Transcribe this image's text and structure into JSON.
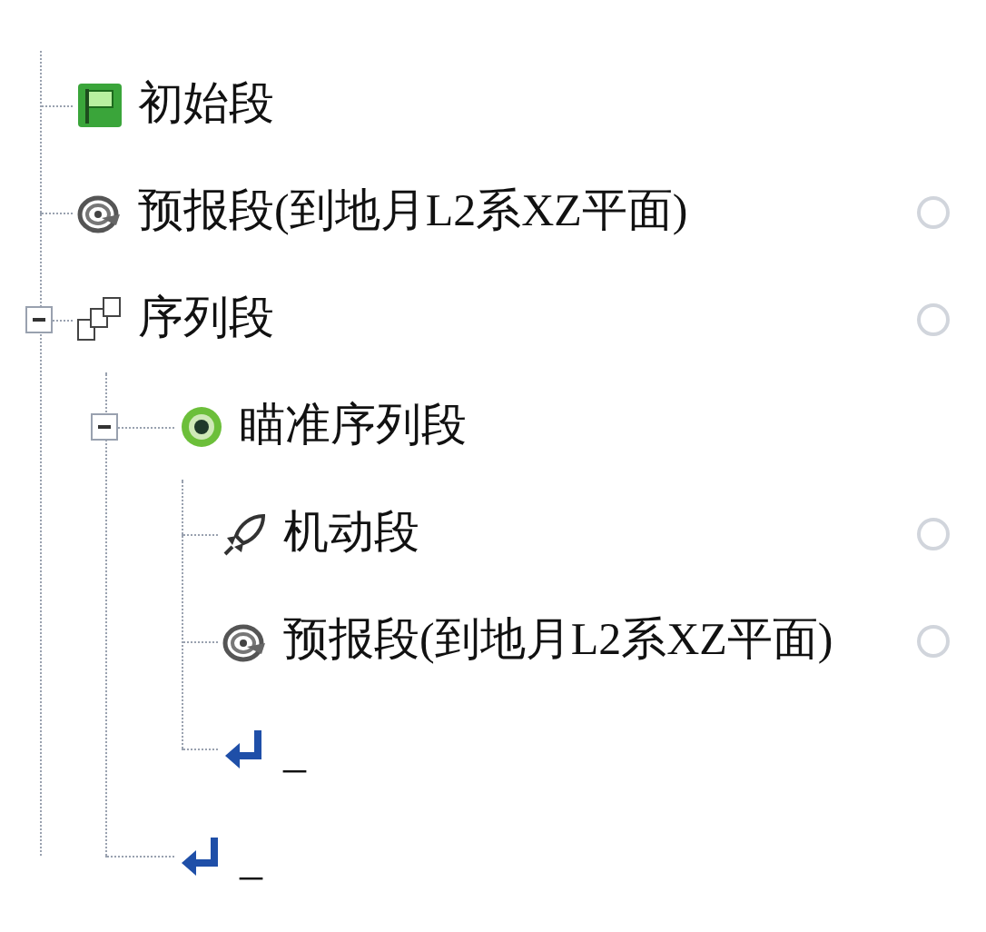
{
  "tree": [
    {
      "label": "初始段",
      "kind": "initial",
      "status_circle": false
    },
    {
      "label": "预报段(到地月L2系XZ平面)",
      "kind": "propagate",
      "status_circle": true
    },
    {
      "label": "序列段",
      "kind": "sequence",
      "status_circle": true,
      "expanded": true,
      "children": [
        {
          "label": "瞄准序列段",
          "kind": "target",
          "status_circle": false,
          "expanded": true,
          "children": [
            {
              "label": "机动段",
              "kind": "maneuver",
              "status_circle": true
            },
            {
              "label": "预报段(到地月L2系XZ平面)",
              "kind": "propagate",
              "status_circle": true
            },
            {
              "label": "_",
              "kind": "return",
              "status_circle": false
            }
          ]
        },
        {
          "label": "_",
          "kind": "return",
          "status_circle": false
        }
      ]
    }
  ]
}
